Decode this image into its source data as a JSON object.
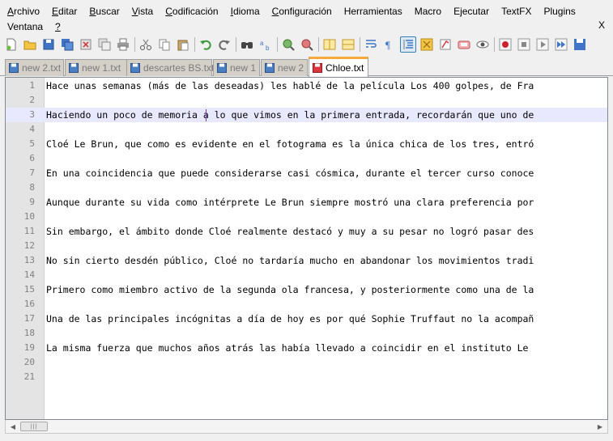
{
  "menubar": {
    "items": [
      {
        "ul": "A",
        "rest": "rchivo"
      },
      {
        "ul": "E",
        "rest": "ditar"
      },
      {
        "ul": "B",
        "rest": "uscar"
      },
      {
        "ul": "V",
        "rest": "ista"
      },
      {
        "ul": "C",
        "rest": "odificación"
      },
      {
        "ul": "I",
        "rest": "dioma"
      },
      {
        "ul": "C",
        "rest": "onfiguración"
      },
      {
        "ul": "",
        "rest": "Herramientas"
      },
      {
        "ul": "",
        "rest": "Macro"
      },
      {
        "ul": "",
        "rest": "Ejecutar"
      },
      {
        "ul": "",
        "rest": "TextFX"
      },
      {
        "ul": "",
        "rest": "Plugins"
      }
    ],
    "row2": [
      {
        "ul": "",
        "rest": "Ventana"
      },
      {
        "ul": "?",
        "rest": ""
      }
    ],
    "close_label": "X"
  },
  "tabs": [
    {
      "label": "new 2.txt",
      "icon": "disk-icon",
      "color": "#4a7fc1"
    },
    {
      "label": "new 1.txt",
      "icon": "disk-icon",
      "color": "#4a7fc1"
    },
    {
      "label": "descartes BS.txt",
      "icon": "disk-icon",
      "color": "#4a7fc1"
    },
    {
      "label": "new 1",
      "icon": "disk-icon",
      "color": "#4a7fc1"
    },
    {
      "label": "new 2",
      "icon": "disk-icon",
      "color": "#4a7fc1"
    },
    {
      "label": "Chloe.txt",
      "icon": "disk-red-icon",
      "color": "#d9363e",
      "active": true
    }
  ],
  "editor": {
    "current_line": 3,
    "lines": [
      {
        "n": "1",
        "text": "Hace unas semanas (más de las deseadas) les hablé de la película Los 400 golpes, de Fra"
      },
      {
        "n": "2",
        "text": ""
      },
      {
        "n": "3",
        "text": "Haciendo un poco de memoria a lo que vimos en la primera entrada, recordarán que uno de"
      },
      {
        "n": "4",
        "text": ""
      },
      {
        "n": "5",
        "text": "Cloé Le Brun, que como es evidente en el fotograma es la única chica de los tres, entró"
      },
      {
        "n": "6",
        "text": ""
      },
      {
        "n": "7",
        "text": "En una coincidencia que puede considerarse casi cósmica, durante el tercer curso conoce"
      },
      {
        "n": "8",
        "text": ""
      },
      {
        "n": "9",
        "text": "Aunque durante su vida como intérprete Le Brun siempre mostró una clara preferencia por"
      },
      {
        "n": "10",
        "text": ""
      },
      {
        "n": "11",
        "text": "Sin embargo, el ámbito donde Cloé realmente destacó y muy a su pesar no logró pasar des"
      },
      {
        "n": "12",
        "text": ""
      },
      {
        "n": "13",
        "text": "No sin cierto desdén público, Cloé no tardaría mucho en abandonar los movimientos tradi"
      },
      {
        "n": "14",
        "text": ""
      },
      {
        "n": "15",
        "text": "Primero como miembro activo de la segunda ola francesa, y posteriormente como una de la"
      },
      {
        "n": "16",
        "text": ""
      },
      {
        "n": "17",
        "text": "Una de las principales incógnitas a día de hoy es por qué Sophie Truffaut no la acompañ"
      },
      {
        "n": "18",
        "text": ""
      },
      {
        "n": "19",
        "text": "La misma fuerza que muchos años atrás las había llevado a coincidir en el instituto Le"
      },
      {
        "n": "20",
        "text": ""
      },
      {
        "n": "21",
        "text": ""
      }
    ]
  },
  "toolbar": {
    "icons": [
      "new-file-icon",
      "open-folder-icon",
      "save-icon",
      "save-all-icon",
      "close-icon",
      "close-all-icon",
      "print-icon",
      "cut-icon",
      "copy-icon",
      "paste-icon",
      "undo-icon",
      "redo-icon",
      "find-icon",
      "replace-icon",
      "zoom-in-icon",
      "zoom-out-icon",
      "sync-vertical-icon",
      "sync-horizontal-icon",
      "word-wrap-icon",
      "show-all-chars-icon",
      "indent-guide-icon",
      "user-language-icon",
      "doc-map-icon",
      "function-list-icon",
      "monitor-icon",
      "record-macro-icon",
      "stop-record-icon",
      "play-macro-icon",
      "run-macro-multiple-icon",
      "save-macro-icon"
    ]
  }
}
